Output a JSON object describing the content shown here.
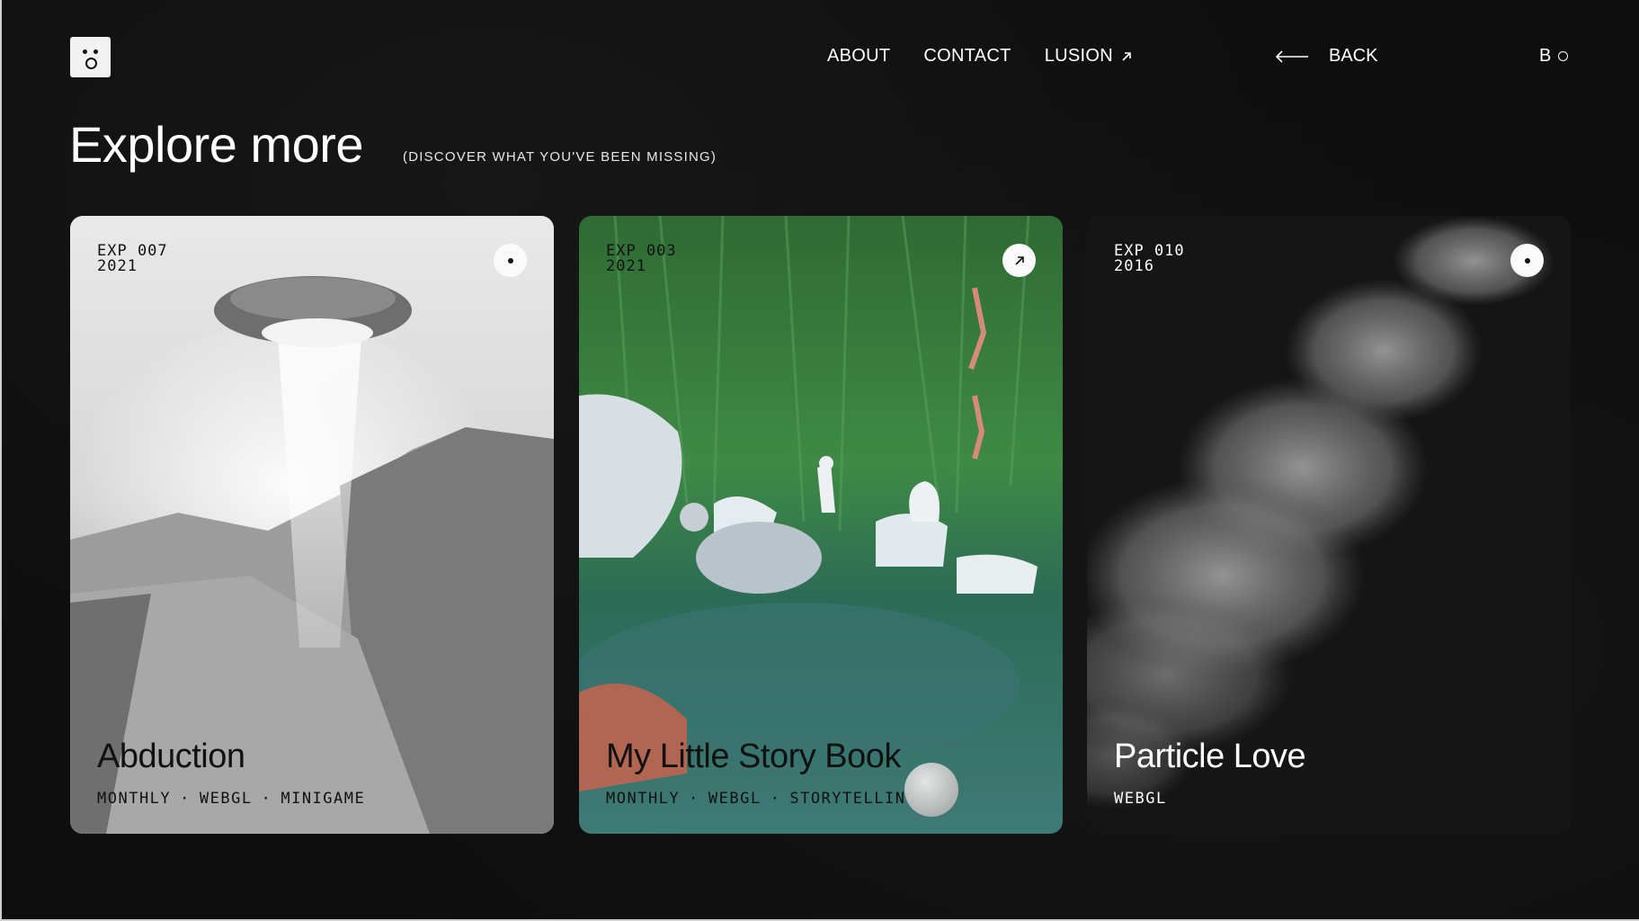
{
  "header": {
    "nav": [
      {
        "label": "ABOUT"
      },
      {
        "label": "CONTACT"
      },
      {
        "label": "LUSION",
        "icon": "arrow-up-right-icon"
      }
    ],
    "back_label": "BACK",
    "corner_label": "B"
  },
  "heading": {
    "title": "Explore more",
    "subtitle": "(DISCOVER WHAT YOU'VE BEEN MISSING)"
  },
  "cards": [
    {
      "exp": "EXP 007",
      "year": "2021",
      "title": "Abduction",
      "tags": [
        "MONTHLY",
        "·",
        "WEBGL",
        "·",
        "MINIGAME"
      ],
      "badge_icon": "dot-icon"
    },
    {
      "exp": "EXP 003",
      "year": "2021",
      "title": "My Little Story Book",
      "tags": [
        "MONTHLY",
        "·",
        "WEBGL",
        "·",
        "STORYTELLING"
      ],
      "badge_icon": "arrow-up-right-icon"
    },
    {
      "exp": "EXP 010",
      "year": "2016",
      "title": "Particle Love",
      "tags": [
        "WEBGL"
      ],
      "badge_icon": "dot-icon"
    }
  ],
  "colors": {
    "background": "#0e0e0e",
    "text": "#ffffff",
    "card_dark_text": "#111111"
  }
}
